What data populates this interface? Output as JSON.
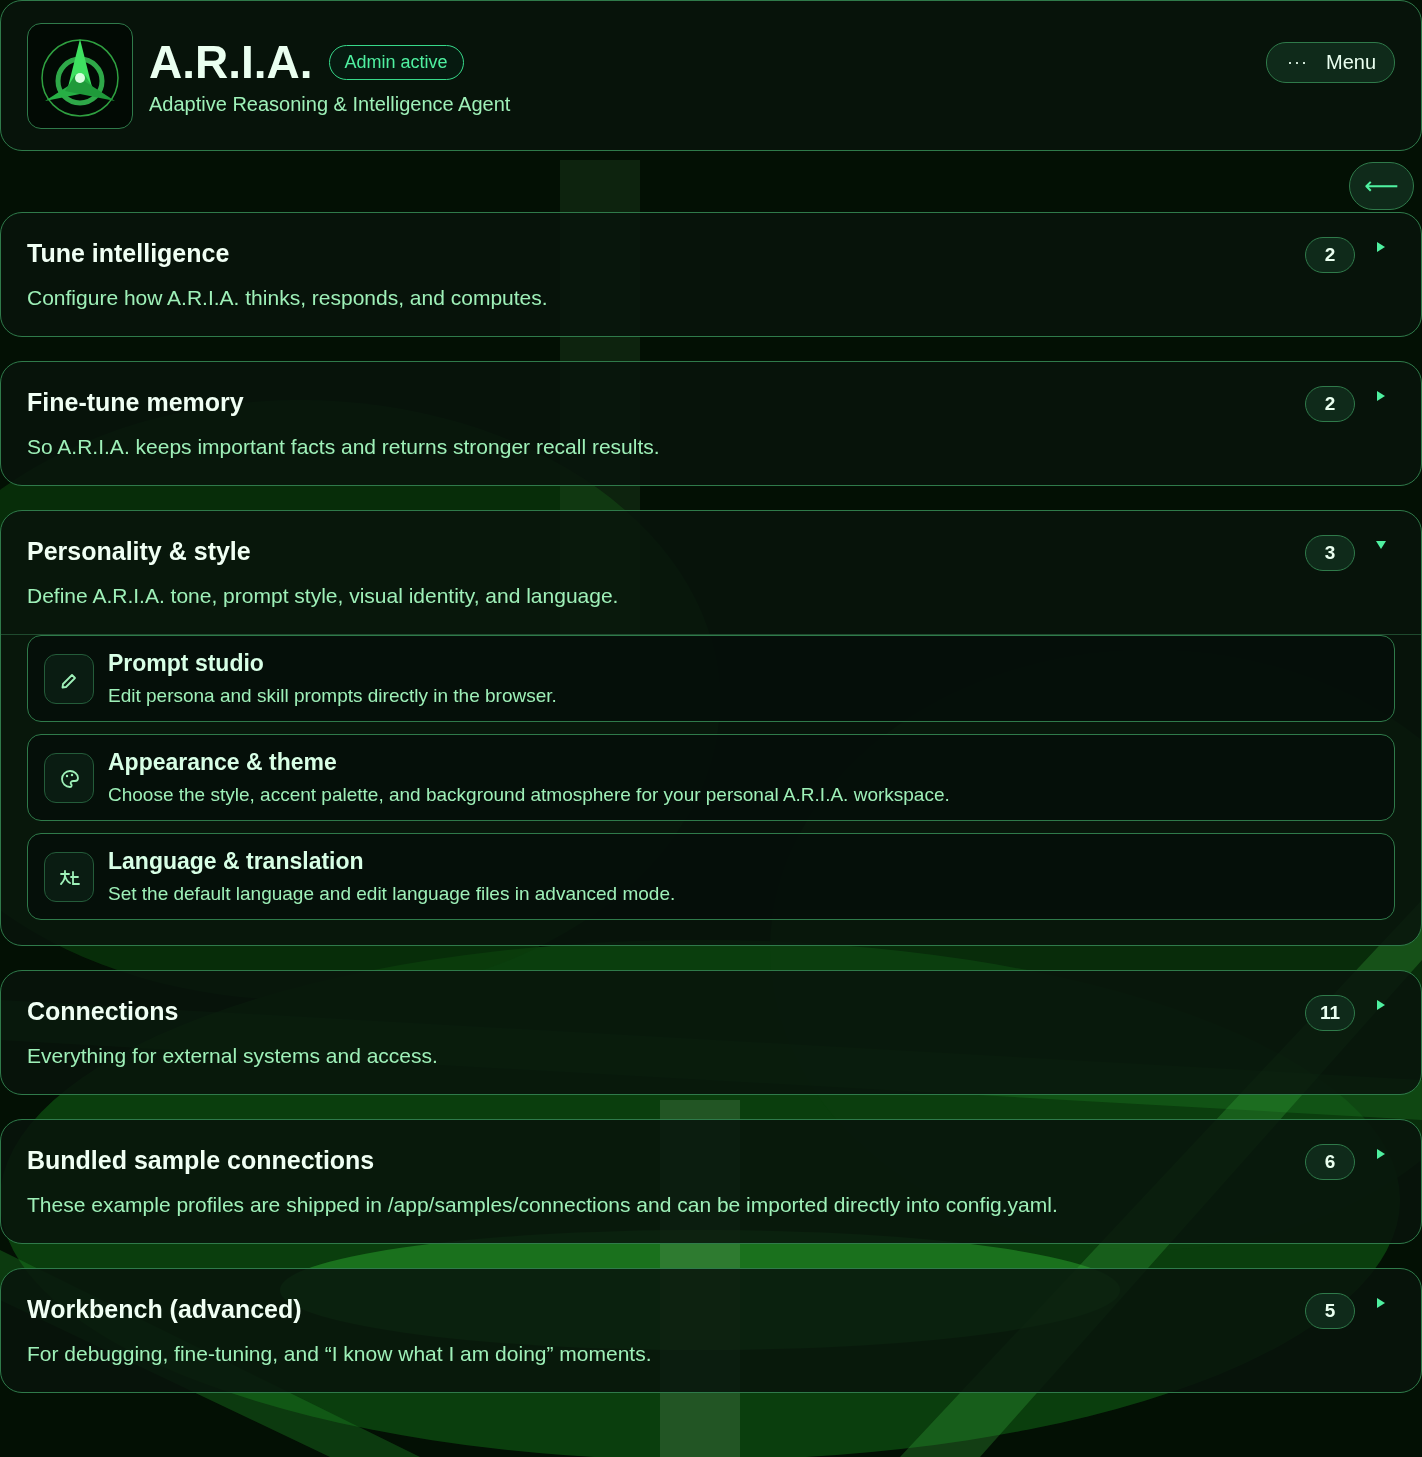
{
  "header": {
    "title": "A.R.I.A.",
    "badge": "Admin active",
    "subtitle": "Adaptive Reasoning & Intelligence Agent",
    "menu_icon": "···",
    "menu_label": "Menu"
  },
  "back_button": "⟵",
  "sections": [
    {
      "title": "Tune intelligence",
      "description": "Configure how A.R.I.A. thinks, responds, and computes.",
      "count": "2",
      "expanded": false
    },
    {
      "title": "Fine-tune memory",
      "description": "So A.R.I.A. keeps important facts and returns stronger recall results.",
      "count": "2",
      "expanded": false
    },
    {
      "title": "Personality & style",
      "description": "Define A.R.I.A. tone, prompt style, visual identity, and language.",
      "count": "3",
      "expanded": true,
      "items": [
        {
          "kind": "pencil",
          "title": "Prompt studio",
          "description": "Edit persona and skill prompts directly in the browser."
        },
        {
          "kind": "palette",
          "title": "Appearance & theme",
          "description": "Choose the style, accent palette, and background atmosphere for your personal A.R.I.A. workspace."
        },
        {
          "kind": "translate",
          "title": "Language & translation",
          "description": "Set the default language and edit language files in advanced mode."
        }
      ]
    },
    {
      "title": "Connections",
      "description": "Everything for external systems and access.",
      "count": "11",
      "expanded": false
    },
    {
      "title": "Bundled sample connections",
      "description": "These example profiles are shipped in /app/samples/connections and can be imported directly into config.yaml.",
      "count": "6",
      "expanded": false
    },
    {
      "title": "Workbench (advanced)",
      "description": "For debugging, fine-tuning, and “I know what I am doing” moments.",
      "count": "5",
      "expanded": false
    }
  ]
}
